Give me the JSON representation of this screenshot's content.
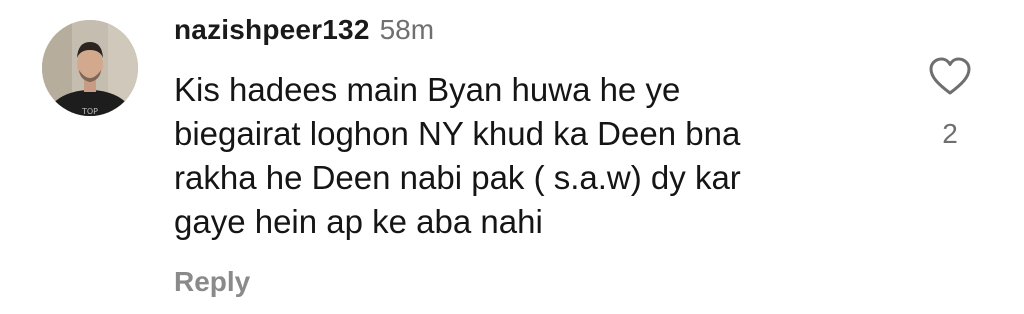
{
  "comment": {
    "username": "nazishpeer132",
    "timestamp": "58m",
    "text_lines": [
      "Kis hadees main Byan huwa he ye",
      "biegairat loghon NY khud ka Deen bna",
      "rakha he Deen nabi pak ( s.a.w) dy kar",
      "gaye hein ap ke aba nahi"
    ],
    "reply_label": "Reply",
    "like_count": "2",
    "like_icon": "heart-outline-icon",
    "avatar_icon": "user-avatar"
  },
  "colors": {
    "text": "#151515",
    "muted": "#6f6f6f",
    "reply": "#8a8a8a",
    "background": "#ffffff"
  }
}
